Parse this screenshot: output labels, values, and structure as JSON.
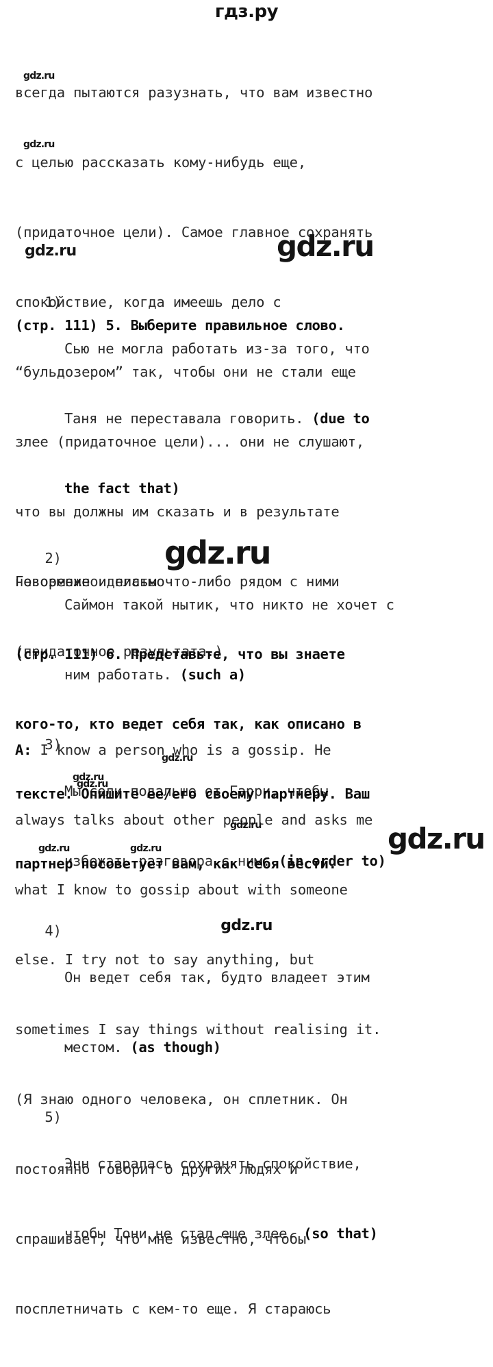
{
  "site": {
    "header_logo": "гдз.ру",
    "footer_logo": "gdz.ru",
    "watermark_text": "gdz.ru",
    "text_color": "#2a2a2a",
    "bold_color": "#0d0d0d",
    "background": "#ffffff"
  },
  "intro_paragraph": {
    "lines": [
      "всегда пытаются разузнать, что вам известно",
      "с целью рассказать кому-нибудь еще,",
      "(придаточное цели). Самое главное сохранять",
      "спокойствие, когда имеешь дело с",
      "“бульдозером” так, чтобы они не стали еще",
      "злее (придаточное цели)... они не слушают,",
      "что вы должны им сказать и в результате",
      "невозможно делать что-либо рядом с ними",
      "(придаточное результата.)"
    ]
  },
  "task5": {
    "heading": "(стр. 111) 5. Выберите правильное слово.",
    "items": [
      {
        "marker": "1)",
        "lines": [
          "Сью не могла работать из-за того, что",
          "Таня не переставала говорить. ",
          "the fact that)"
        ],
        "answer_inline": "(due to",
        "full_text": "Сью не могла работать из-за того, что Таня не переставала говорить. (due to the fact that)"
      },
      {
        "marker": "2)",
        "lines": [
          "Саймон такой нытик, что никто не хочет с",
          "ним работать. "
        ],
        "answer_inline": "(such a)",
        "full_text": "Саймон такой нытик, что никто не хочет с ним работать. (such a)"
      },
      {
        "marker": "3)",
        "lines": [
          "Мы сели подальше от Гарри, чтобы",
          "избежать разговора с ним. "
        ],
        "answer_inline": "(in order to)",
        "full_text": "Мы сели подальше от Гарри, чтобы избежать разговора с ним. (in order to)"
      },
      {
        "marker": "4)",
        "lines": [
          "Он ведет себя так, будто владеет этим",
          "местом. "
        ],
        "answer_inline": "(as though)",
        "full_text": "Он ведет себя так, будто владеет этим местом. (as though)"
      },
      {
        "marker": "5)",
        "lines": [
          "Энн старалась сохранять спокойствие,",
          "чтобы Тони не стал еще злее. "
        ],
        "answer_inline": "(so that)",
        "full_text": "Энн старалась сохранять спокойствие, чтобы Тони не стал еще злее. (so that)"
      }
    ]
  },
  "section_title": "Говорение и письмо",
  "task6": {
    "heading_lines": [
      "(стр. 111) 6. Представьте, что вы знаете",
      "кого-то, кто ведет себя так, как описано в",
      "тексте. Опишите ее/его своему партнеру. Ваш",
      "партнер посоветует вам, как себя вести."
    ],
    "answer_label": "A:",
    "answer_english_lines": [
      " I know a person who is a gossip. He",
      "always talks about other people and asks me",
      "what I know to gossip about with someone",
      "else. I try not to say anything, but",
      "sometimes I say things without realising it."
    ],
    "answer_russian_lines": [
      "(Я знаю одного человека, он сплетник. Он",
      "постоянно говорит о других людях и",
      "спрашивает, что мне известно, чтобы",
      "посплетничать с кем-то еще. Я стараюсь"
    ]
  }
}
